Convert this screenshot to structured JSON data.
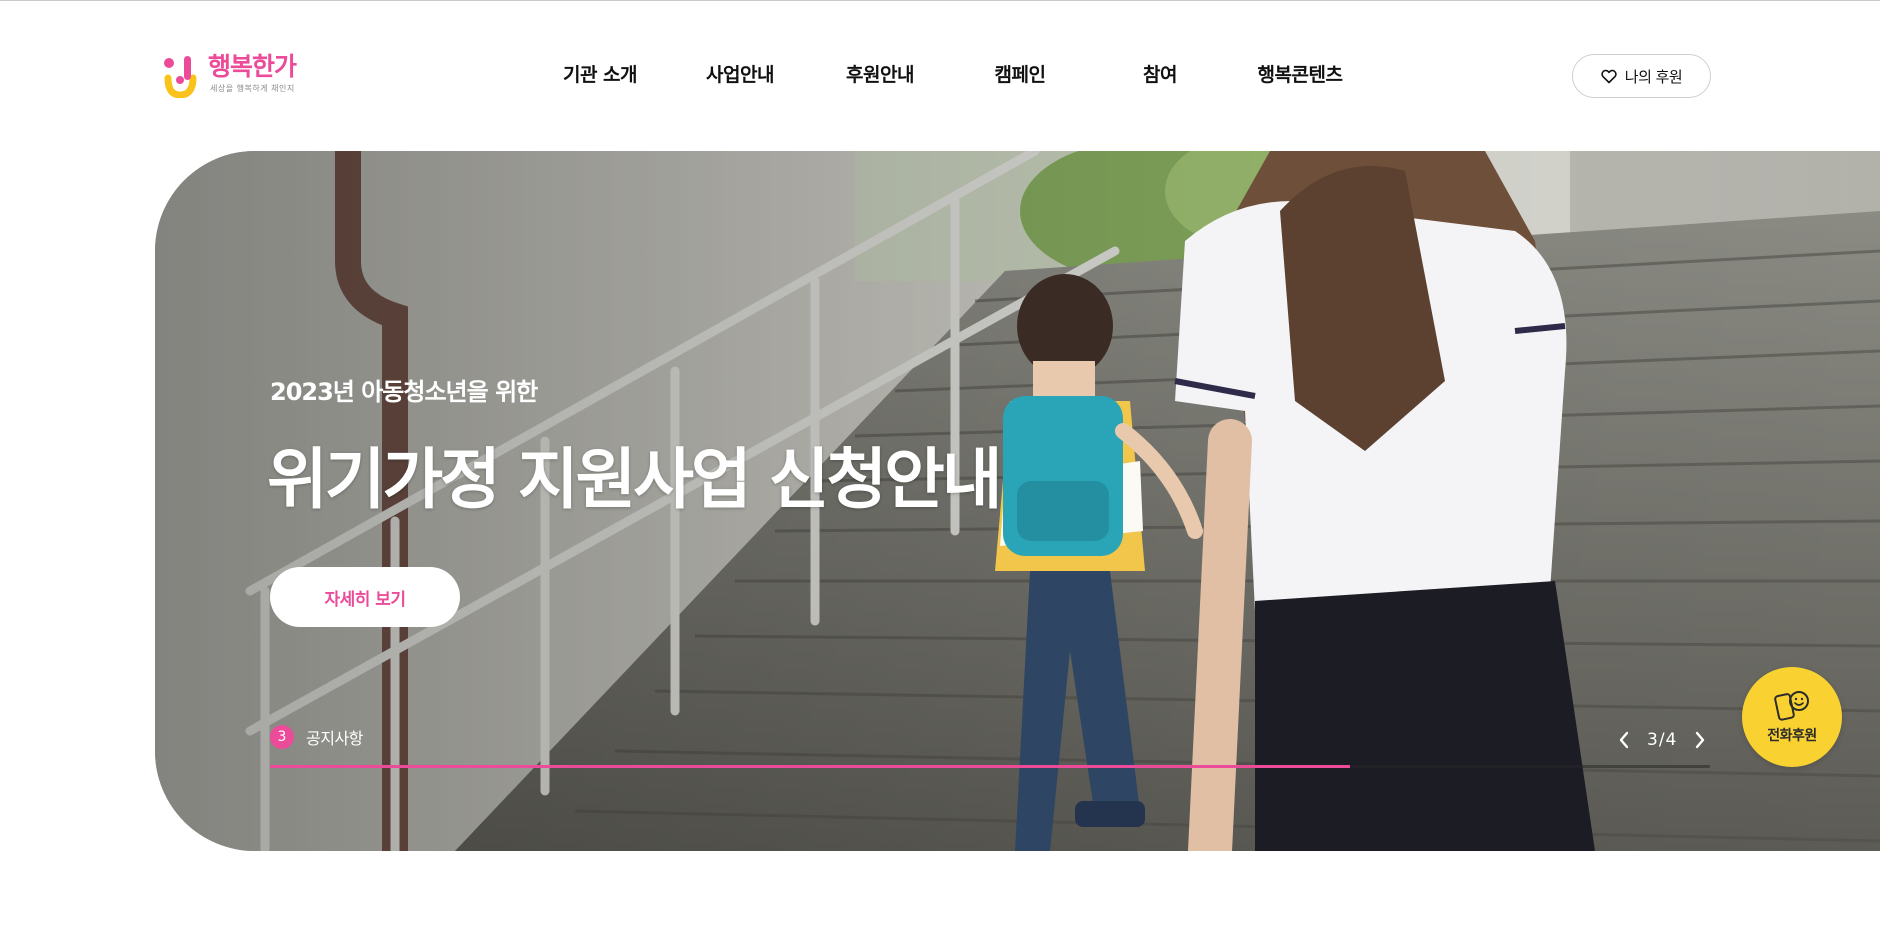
{
  "brand": {
    "name": "행복한가",
    "tagline": "세상을 행복하게 채인지",
    "color_pink": "#ec4b9a",
    "color_yellow": "#f9d232"
  },
  "nav": {
    "items": [
      {
        "label": "기관 소개"
      },
      {
        "label": "사업안내"
      },
      {
        "label": "후원안내"
      },
      {
        "label": "캠페인"
      },
      {
        "label": "참여"
      },
      {
        "label": "행복콘텐츠"
      }
    ]
  },
  "header": {
    "my_support_label": "나의 후원",
    "my_support_icon": "heart-outline-icon"
  },
  "hero": {
    "subtitle": "2023년 아동청소년을 위한",
    "title": "위기가정 지원사업 신청안내",
    "button_label": "자세히 보기",
    "notice_number": "3",
    "notice_label": "공지사항",
    "progress": 0.75,
    "pager_text": "3/4",
    "image_subject": "child with teal backpack climbing outdoor stairs beside a girl in school uniform"
  },
  "floating": {
    "phone_donate_label": "전화후원",
    "phone_donate_icon": "phone-smile-icon"
  }
}
